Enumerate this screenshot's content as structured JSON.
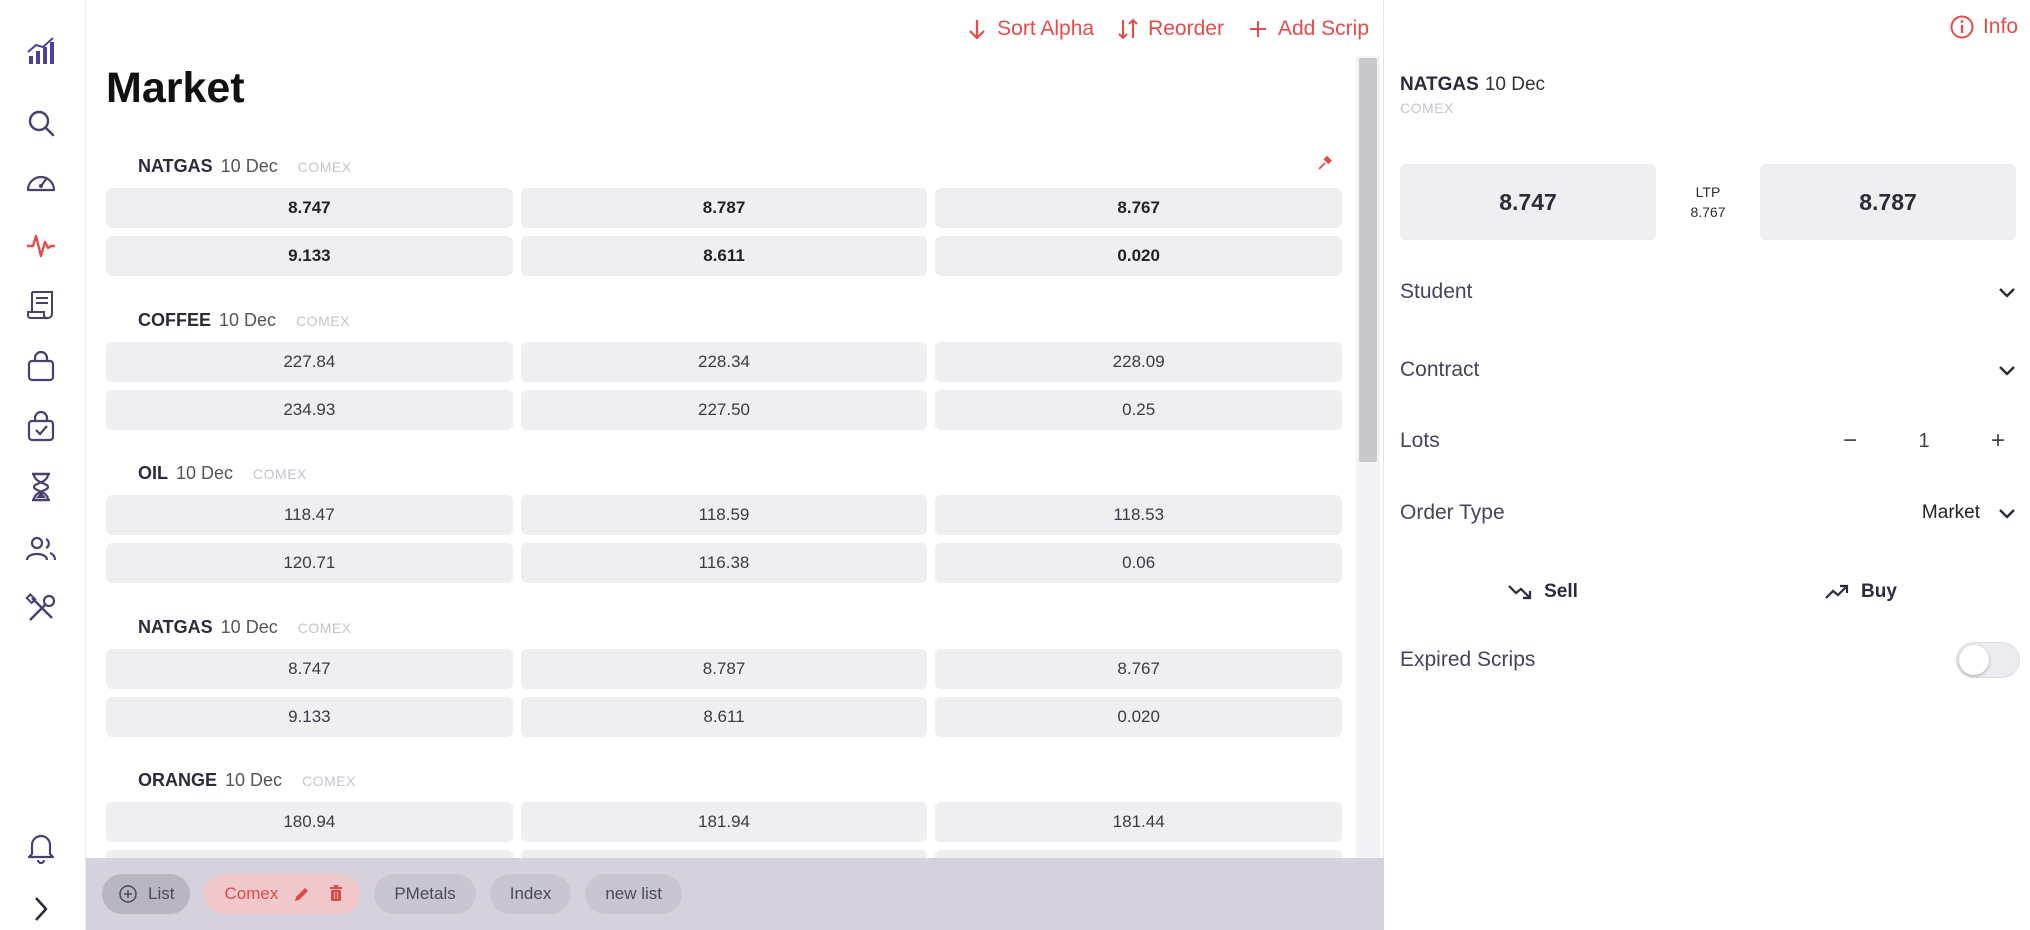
{
  "toolbar": {
    "sort_label": "Sort Alpha",
    "reorder_label": "Reorder",
    "add_label": "Add Scrip"
  },
  "main": {
    "title": "Market"
  },
  "scrips": [
    {
      "symbol": "NATGAS",
      "expiry": "10 Dec",
      "exchange": "COMEX",
      "bold": true,
      "row1": [
        "8.747",
        "8.787",
        "8.767"
      ],
      "row2": [
        "9.133",
        "8.611",
        "0.020"
      ]
    },
    {
      "symbol": "COFFEE",
      "expiry": "10 Dec",
      "exchange": "COMEX",
      "bold": false,
      "row1": [
        "227.84",
        "228.34",
        "228.09"
      ],
      "row2": [
        "234.93",
        "227.50",
        "0.25"
      ]
    },
    {
      "symbol": "OIL",
      "expiry": "10 Dec",
      "exchange": "COMEX",
      "bold": false,
      "row1": [
        "118.47",
        "118.59",
        "118.53"
      ],
      "row2": [
        "120.71",
        "116.38",
        "0.06"
      ]
    },
    {
      "symbol": "NATGAS",
      "expiry": "10 Dec",
      "exchange": "COMEX",
      "bold": false,
      "row1": [
        "8.747",
        "8.787",
        "8.767"
      ],
      "row2": [
        "9.133",
        "8.611",
        "0.020"
      ]
    },
    {
      "symbol": "ORANGE",
      "expiry": "10 Dec",
      "exchange": "COMEX",
      "bold": false,
      "row1": [
        "180.94",
        "181.94",
        "181.44"
      ],
      "row2": [
        "",
        "",
        ""
      ]
    }
  ],
  "lists": {
    "add_label": "List",
    "items": [
      "Comex",
      "PMetals",
      "Index",
      "new list"
    ],
    "active": "Comex"
  },
  "side": {
    "info_label": "Info",
    "symbol": "NATGAS",
    "expiry": "10 Dec",
    "exchange": "COMEX",
    "bid": "8.747",
    "ask": "8.787",
    "ltp_label": "LTP",
    "ltp_value": "8.767",
    "student_label": "Student",
    "contract_label": "Contract",
    "lots_label": "Lots",
    "lots_value": "1",
    "order_type_label": "Order Type",
    "order_type_value": "Market",
    "sell_label": "Sell",
    "buy_label": "Buy",
    "expired_label": "Expired Scrips",
    "expired_on": false
  },
  "colors": {
    "accent": "#e54b4b",
    "brand_icon": "#4b3fa0",
    "cell_bg": "#efeff1",
    "listbar_bg": "#d6d2dd"
  },
  "icons": {
    "rail": [
      "chart-bars-icon",
      "search-icon",
      "speedometer-icon",
      "pulse-icon",
      "receipt-icon",
      "bag-icon",
      "bag-check-icon",
      "hourglass-icon",
      "users-icon",
      "tools-icon",
      "bell-icon",
      "chevron-right-icon"
    ]
  }
}
